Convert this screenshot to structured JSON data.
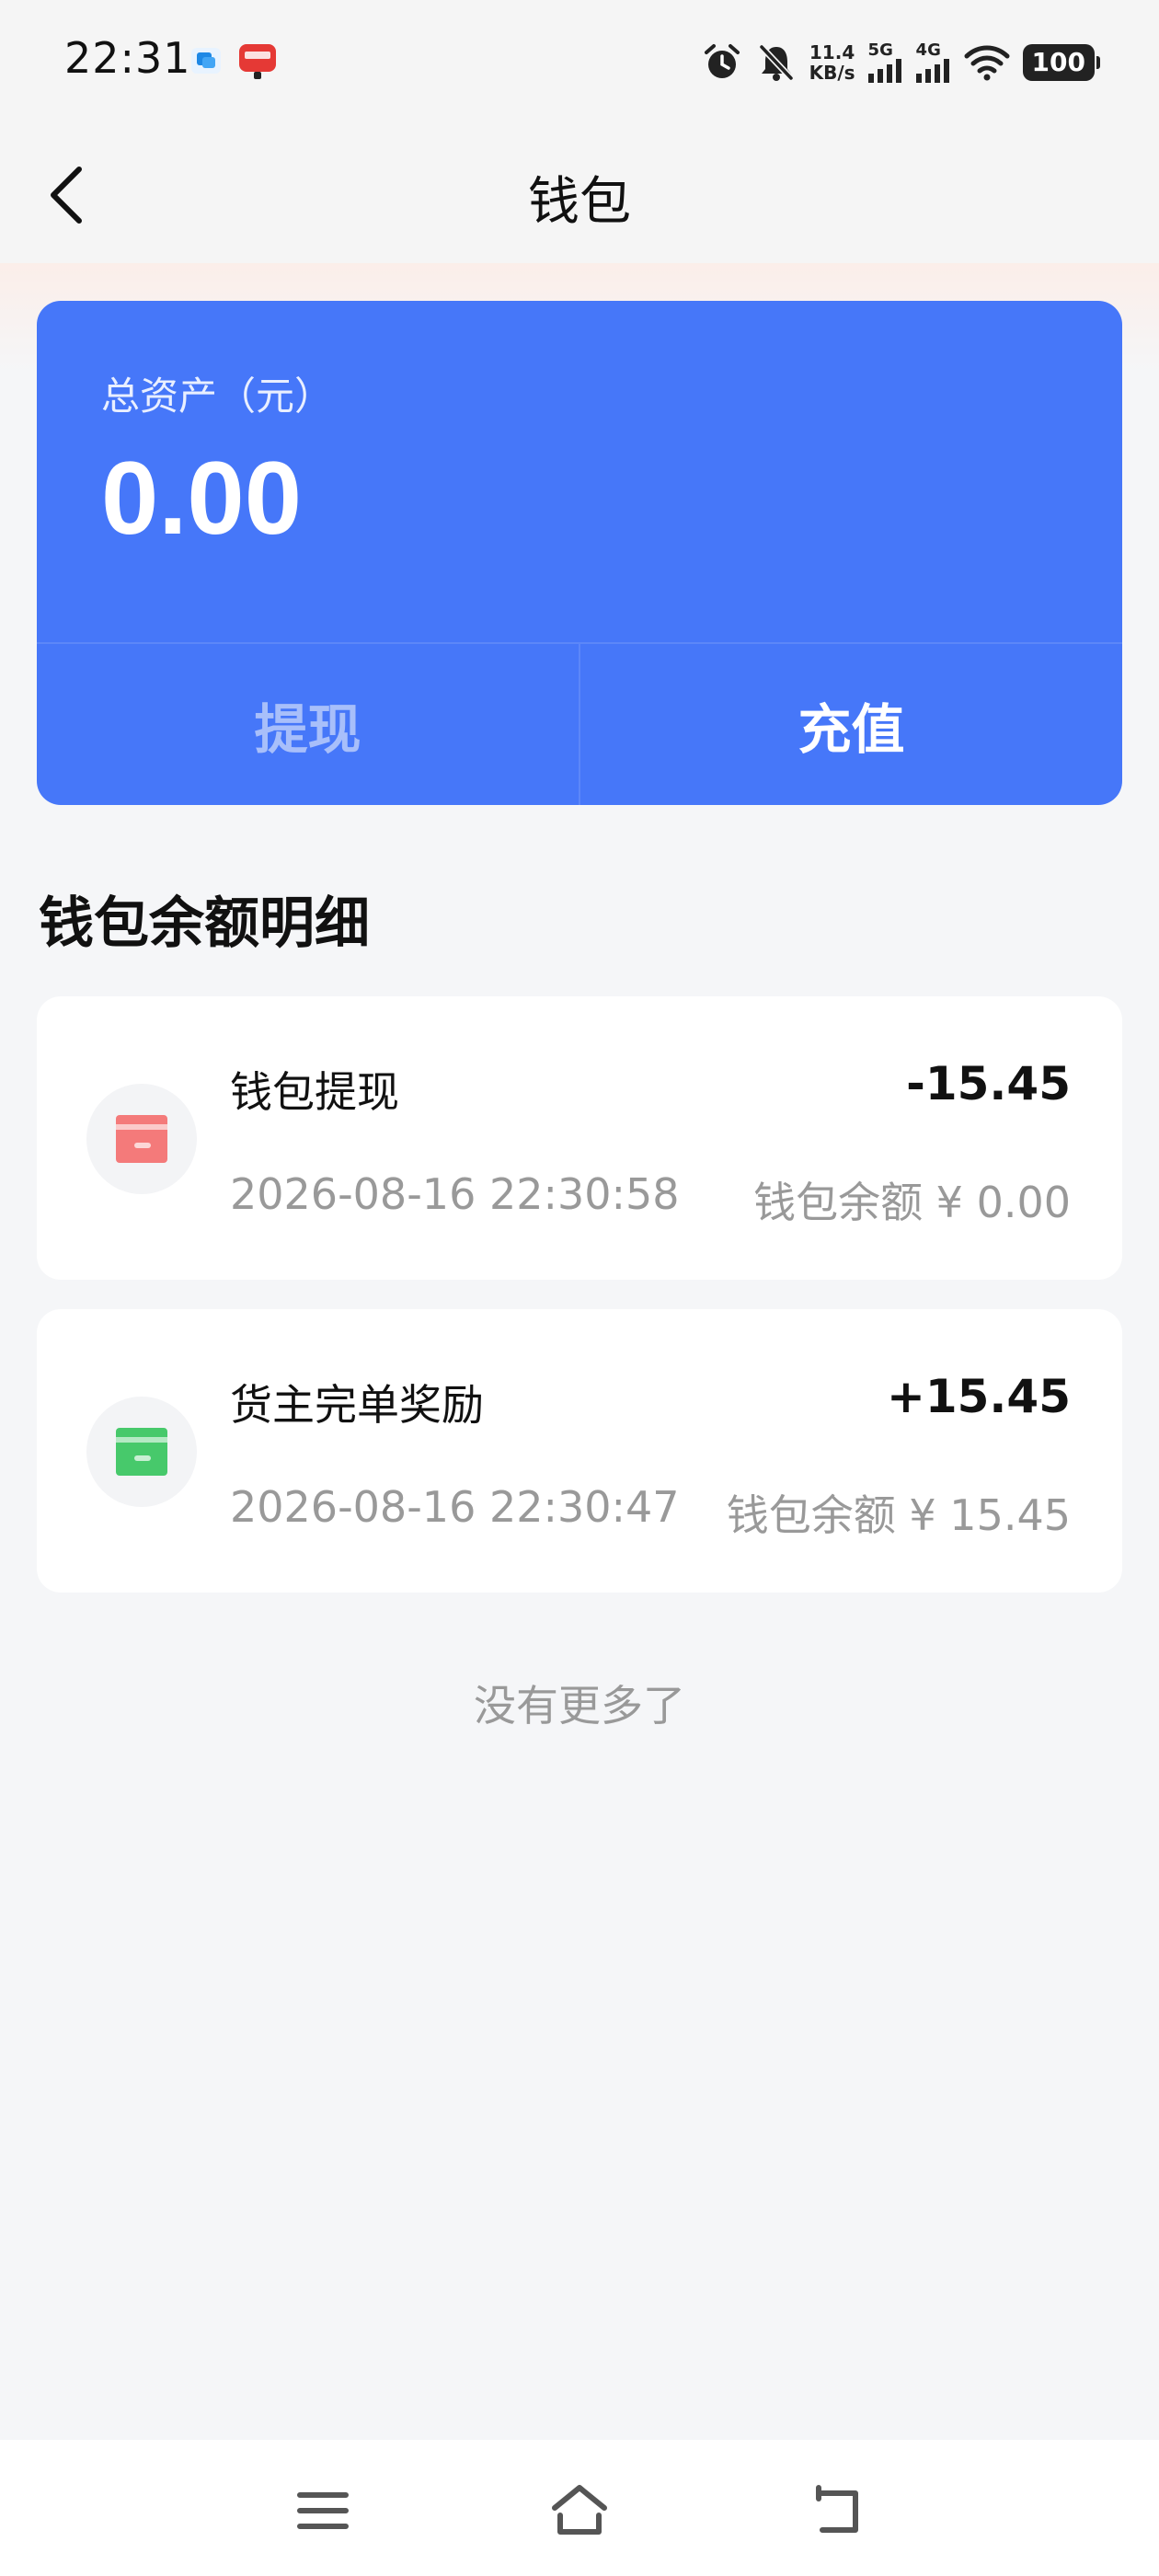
{
  "status_bar": {
    "time": "22:31",
    "net_speed_value": "11.4",
    "net_speed_unit": "KB/s",
    "signal1_label": "5G",
    "signal2_label": "4G",
    "battery": "100"
  },
  "header": {
    "title": "钱包"
  },
  "asset_card": {
    "label": "总资产（元）",
    "amount": "0.00",
    "withdraw_label": "提现",
    "recharge_label": "充值"
  },
  "section_title": "钱包余额明细",
  "transactions": [
    {
      "title": "钱包提现",
      "amount": "-15.45",
      "time": "2026-08-16 22:30:58",
      "balance": "钱包余额 ¥ 0.00",
      "icon": "card-icon-red",
      "icon_color": "#f47a7a"
    },
    {
      "title": "货主完单奖励",
      "amount": "+15.45",
      "time": "2026-08-16 22:30:47",
      "balance": "钱包余额 ¥ 15.45",
      "icon": "card-icon-green",
      "icon_color": "#47c96b"
    }
  ],
  "list_end": "没有更多了",
  "colors": {
    "accent": "#4677f9",
    "background": "#f5f6f8"
  }
}
